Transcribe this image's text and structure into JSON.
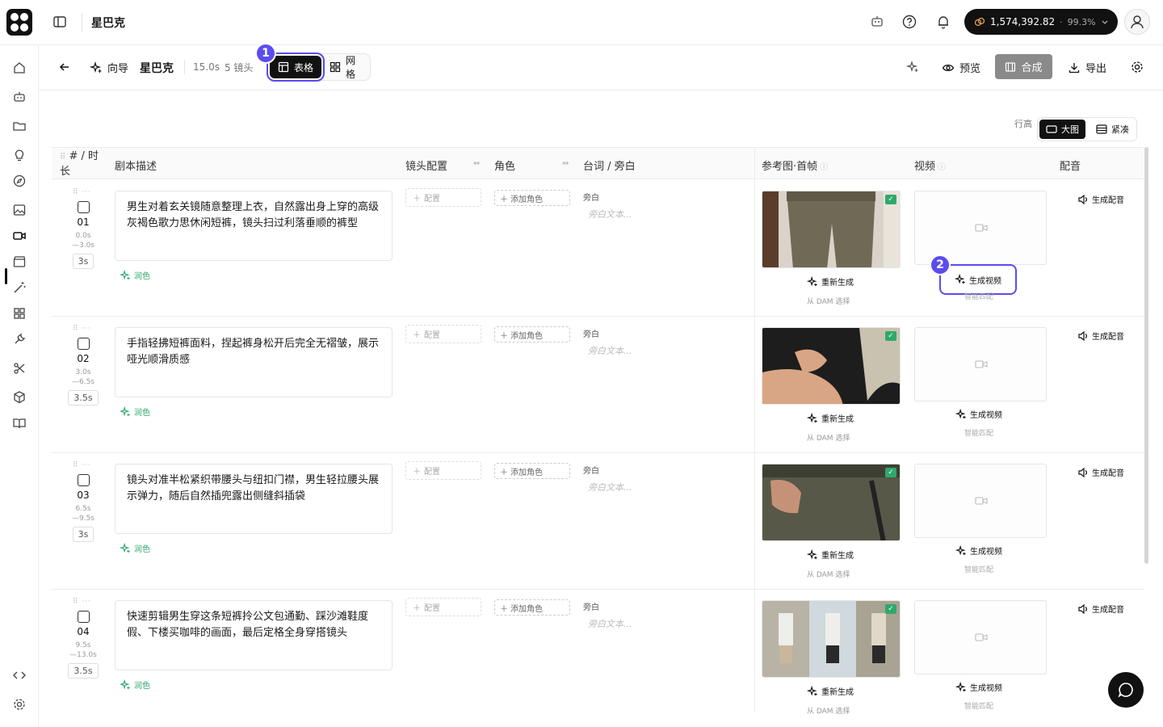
{
  "topbar": {
    "project_name": "星巴克",
    "credits": "1,574,392.82",
    "credit_sep": "·",
    "credit_pct": "99.3%"
  },
  "toolbar": {
    "wizard_label": "向导",
    "project_name": "星巴克",
    "duration": "15.0s",
    "shots": "5 镜头",
    "view_table": "表格",
    "view_grid": "网格",
    "preview": "预览",
    "compose": "合成",
    "export": "导出",
    "badge1": "1",
    "badge2": "2"
  },
  "row_height": {
    "label": "行高",
    "large": "大图",
    "compact": "紧凑"
  },
  "table": {
    "headers": {
      "num": "# / 时长",
      "script": "剧本描述",
      "shot_config": "镜头配置",
      "role": "角色",
      "dialogue": "台词 / 旁白",
      "ref": "参考图·首帧",
      "video": "视频",
      "audio": "配音"
    },
    "labels": {
      "config": "配置",
      "add_role": "添加角色",
      "voiceover": "旁白",
      "voiceover_placeholder": "旁白文本...",
      "polish": "润色",
      "regenerate": "重新生成",
      "dam": "从 DAM 选择",
      "gen_video": "生成视频",
      "smart_match": "智能匹配",
      "gen_audio": "生成配音",
      "drag": "⠿ ···"
    },
    "rows": [
      {
        "num": "01",
        "start": "0.0s",
        "end": "—3.0s",
        "dur": "3s",
        "script": "男生对着玄关镜随意整理上衣，自然露出身上穿的高级灰褐色歌力思休闲短裤，镜头扫过利落垂顺的裤型"
      },
      {
        "num": "02",
        "start": "3.0s",
        "end": "—6.5s",
        "dur": "3.5s",
        "script": "手指轻拂短裤面料，捏起裤身松开后完全无褶皱，展示哑光顺滑质感"
      },
      {
        "num": "03",
        "start": "6.5s",
        "end": "—9.5s",
        "dur": "3s",
        "script": "镜头对准半松紧织带腰头与纽扣门襟，男生轻拉腰头展示弹力，随后自然插兜露出侧缝斜插袋"
      },
      {
        "num": "04",
        "start": "9.5s",
        "end": "—13.0s",
        "dur": "3.5s",
        "script": "快速剪辑男生穿这条短裤拎公文包通勤、踩沙滩鞋度假、下楼买咖啡的画面，最后定格全身穿搭镜头"
      }
    ]
  },
  "colors": {
    "accent": "#5b4cf0",
    "green": "#2fa96b",
    "dark": "#111111"
  }
}
